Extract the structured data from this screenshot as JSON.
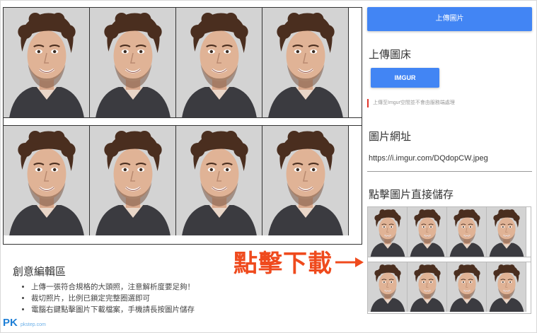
{
  "right_panel": {
    "upload_button_label": "上傳圖片",
    "image_host_title": "上傳圖床",
    "imgur_button_label": "IMGUR",
    "notice": "上傳至Imgur空間並不會由服務端處理",
    "image_url_title": "圖片網址",
    "image_url": "https://i.imgur.com/DQdopCW.jpeg",
    "save_title": "點擊圖片直接儲存"
  },
  "editor": {
    "title": "創意編輯區",
    "tips": [
      "上傳一張符合規格的大頭照，注意解析度要足夠！",
      "裁切照片，比例已鎖定完整圈選即可",
      "電腦右鍵點擊圖片下載檔案，手機請長按圖片儲存"
    ]
  },
  "annotation": {
    "text": "點擊下載",
    "color": "#ef4a1d"
  },
  "watermark": {
    "text": "PK",
    "subtext": "pkstep.com"
  },
  "colors": {
    "accent_blue": "#4285f4",
    "notice_red": "#e0352b"
  },
  "icons": {
    "arrow": "arrow-right-icon"
  }
}
